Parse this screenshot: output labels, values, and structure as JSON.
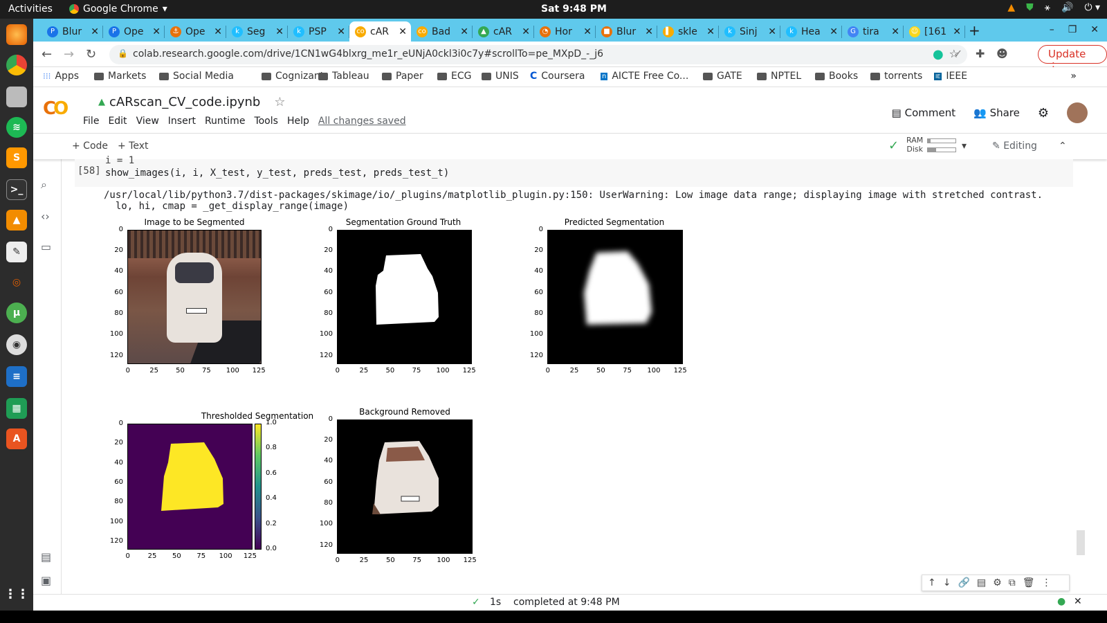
{
  "system": {
    "activities": "Activities",
    "app_name": "Google Chrome",
    "clock": "Sat  9:48 PM"
  },
  "tabs": [
    {
      "label": "Blur",
      "color": "#1a73e8",
      "letter": "P"
    },
    {
      "label": "Ope",
      "color": "#1a73e8",
      "letter": "P"
    },
    {
      "label": "Ope",
      "color": "#e8710a",
      "letter": "⚓"
    },
    {
      "label": "Seg",
      "color": "#20beff",
      "letter": "k"
    },
    {
      "label": "PSP",
      "color": "#20beff",
      "letter": "k"
    },
    {
      "label": "cAR",
      "color": "#f9ab00",
      "letter": "co",
      "active": true
    },
    {
      "label": "Bad",
      "color": "#f9ab00",
      "letter": "co"
    },
    {
      "label": "cAR",
      "color": "#34a853",
      "letter": "▲"
    },
    {
      "label": "Hor",
      "color": "#e8710a",
      "letter": "◔"
    },
    {
      "label": "Blur",
      "color": "#e8710a",
      "letter": "■"
    },
    {
      "label": "skle",
      "color": "#f9ab00",
      "letter": "▌"
    },
    {
      "label": "Sinj",
      "color": "#20beff",
      "letter": "k"
    },
    {
      "label": "Hea",
      "color": "#20beff",
      "letter": "k"
    },
    {
      "label": "tira",
      "color": "#4285f4",
      "letter": "G"
    },
    {
      "label": "[161",
      "color": "#f9d71c",
      "letter": "☺"
    }
  ],
  "address": {
    "url": "colab.research.google.com/drive/1CN1wG4blxrg_me1r_eUNjA0ckl3i0c7y#scrollTo=pe_MXpD_-_j6",
    "update_label": "Update"
  },
  "bookmarks": [
    "Apps",
    "Markets",
    "Social Media",
    "Cognizant",
    "Tableau",
    "Paper",
    "ECG",
    "UNIS",
    "Coursera",
    "AICTE Free Co...",
    "GATE",
    "NPTEL",
    "Books",
    "torrents",
    "IEEE"
  ],
  "notebook": {
    "title": "cARscan_CV_code.ipynb",
    "menus": [
      "File",
      "Edit",
      "View",
      "Insert",
      "Runtime",
      "Tools",
      "Help"
    ],
    "saved_status": "All changes saved",
    "comment_label": "Comment",
    "share_label": "Share",
    "add_code": "+ Code",
    "add_text": "+ Text",
    "ram_label": "RAM",
    "disk_label": "Disk",
    "ram_usage": 0.1,
    "disk_usage": 0.3,
    "editing_label": "Editing"
  },
  "cell": {
    "code_line1": "i = 1",
    "exec_count": "[58]",
    "code_line2": "show_images(i, i, X_test, y_test, preds_test, preds_test_t)",
    "warning_line1": "/usr/local/lib/python3.7/dist-packages/skimage/io/_plugins/matplotlib_plugin.py:150: UserWarning: Low image data range; displaying image with stretched contrast.",
    "warning_line2": "  lo, hi, cmap = _get_display_range(image)"
  },
  "plots": {
    "p1_title": "Image to be Segmented",
    "p2_title": "Segmentation Ground Truth",
    "p3_title": "Predicted Segmentation",
    "p4_title": "Thresholded Segmentation",
    "p5_title": "Background Removed",
    "y_ticks": [
      "0",
      "20",
      "40",
      "60",
      "80",
      "100",
      "120"
    ],
    "x_ticks": [
      "0",
      "25",
      "50",
      "75",
      "100",
      "125"
    ],
    "colorbar_ticks": [
      "1.0",
      "0.8",
      "0.6",
      "0.4",
      "0.2",
      "0.0"
    ]
  },
  "status": {
    "duration": "1s",
    "completed": "completed at 9:48 PM"
  }
}
